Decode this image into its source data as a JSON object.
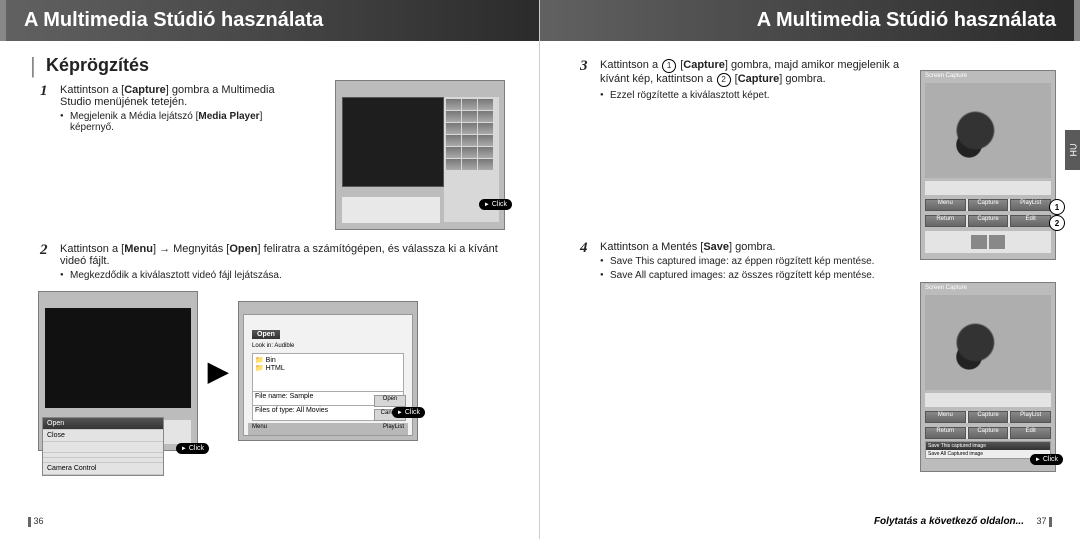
{
  "header": {
    "title": "A Multimedia Stúdió használata"
  },
  "section": {
    "title": "Képrögzítés"
  },
  "steps": {
    "s1": {
      "num": "1",
      "text_pre": "Kattintson a [",
      "b1": "Capture",
      "text_post": "] gombra a Multimedia Studio menüjének tetején."
    },
    "s1_bullet": {
      "pre": "Megjelenik a Média lejátszó [",
      "b": "Media Player",
      "post": "] képernyő."
    },
    "s2": {
      "num": "2",
      "pre": "Kattintson a [",
      "b1": "Menu",
      "mid1": "] → Megnyitás [",
      "b2": "Open",
      "post": "] feliratra a számítógépen, és válassza ki a kívánt videó fájlt."
    },
    "s2_bullet": "Megkezdődik a kiválasztott videó fájl lejátszása.",
    "s3": {
      "num": "3",
      "pre": "Kattintson a ",
      "c1": "1",
      "mid1": " [",
      "b1": "Capture",
      "mid2": "] gombra, majd amikor megjelenik a kívánt kép, kattintson a ",
      "c2": "2",
      "mid3": " [",
      "b2": "Capture",
      "post": "] gombra."
    },
    "s3_bullet": "Ezzel rögzítette a kiválasztott képet.",
    "s4": {
      "num": "4",
      "pre": "Kattintson a Mentés [",
      "b": "Save",
      "post": "] gombra."
    },
    "s4_b1": "Save This captured image: az éppen rögzített kép mentése.",
    "s4_b2": "Save All captured images: az összes rögzített kép mentése."
  },
  "ui": {
    "click": "Click",
    "open": "Open",
    "close": "Close",
    "menu": "Menu",
    "playlist": "PlayList",
    "camera_control": "Camera Control",
    "screen_capture": "Screen Capture",
    "lookin": "Look in:",
    "audible": "Audible",
    "bin": "Bin",
    "html": "HTML",
    "filename": "File name:",
    "sample": "Sample",
    "filesoftype": "Files of type:",
    "allmovies": "All Movies",
    "cancel": "Cancel",
    "capture": "Capture",
    "return": "Return",
    "edit": "Edit",
    "save_this": "Save This captured image",
    "save_all": "Save All Captured image"
  },
  "footer": {
    "p36": "36",
    "p37": "37",
    "continue": "Folytatás a következő oldalon...",
    "lang": "HU"
  }
}
